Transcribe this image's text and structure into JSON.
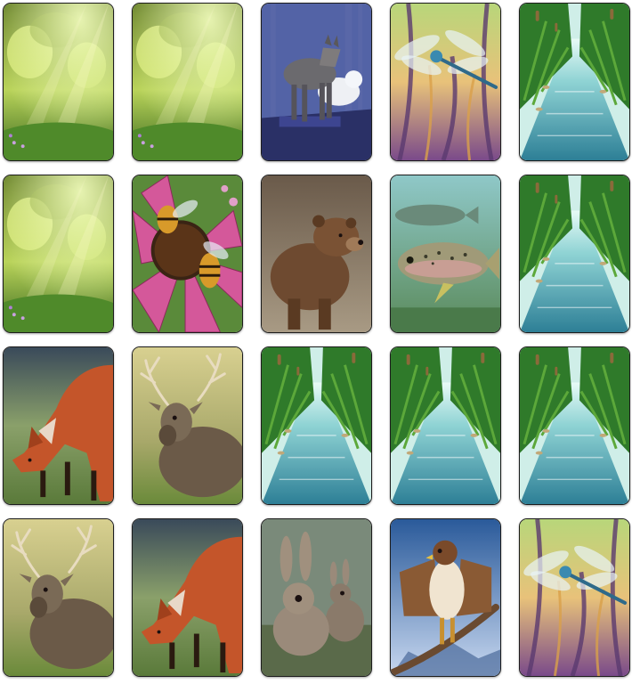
{
  "board": {
    "rows": 4,
    "cols": 5,
    "cards": [
      {
        "face": "forest-glade",
        "state": "face-down"
      },
      {
        "face": "forest-glade",
        "state": "face-down"
      },
      {
        "face": "gray-wolves",
        "state": "face-up"
      },
      {
        "face": "dragonfly",
        "state": "face-up"
      },
      {
        "face": "stream",
        "state": "face-down"
      },
      {
        "face": "forest-glade",
        "state": "face-down"
      },
      {
        "face": "bee-on-coneflower",
        "state": "face-up"
      },
      {
        "face": "brown-bear",
        "state": "face-up"
      },
      {
        "face": "trout",
        "state": "face-up"
      },
      {
        "face": "stream",
        "state": "face-down"
      },
      {
        "face": "red-fox",
        "state": "face-up"
      },
      {
        "face": "white-tailed-deer",
        "state": "face-up"
      },
      {
        "face": "stream",
        "state": "face-down"
      },
      {
        "face": "stream",
        "state": "face-down"
      },
      {
        "face": "stream",
        "state": "face-down"
      },
      {
        "face": "white-tailed-deer",
        "state": "face-up"
      },
      {
        "face": "red-fox",
        "state": "face-up"
      },
      {
        "face": "cottontail-rabbits",
        "state": "face-up"
      },
      {
        "face": "red-tailed-hawk",
        "state": "face-up"
      },
      {
        "face": "dragonfly",
        "state": "face-up"
      }
    ]
  },
  "colors": {
    "border": "#1d1d1d",
    "glade": "#a8c84a",
    "stream": "#3f9bb0",
    "fox": "#c4552a",
    "bear": "#6e4a30",
    "deer": "#6b5a48"
  }
}
